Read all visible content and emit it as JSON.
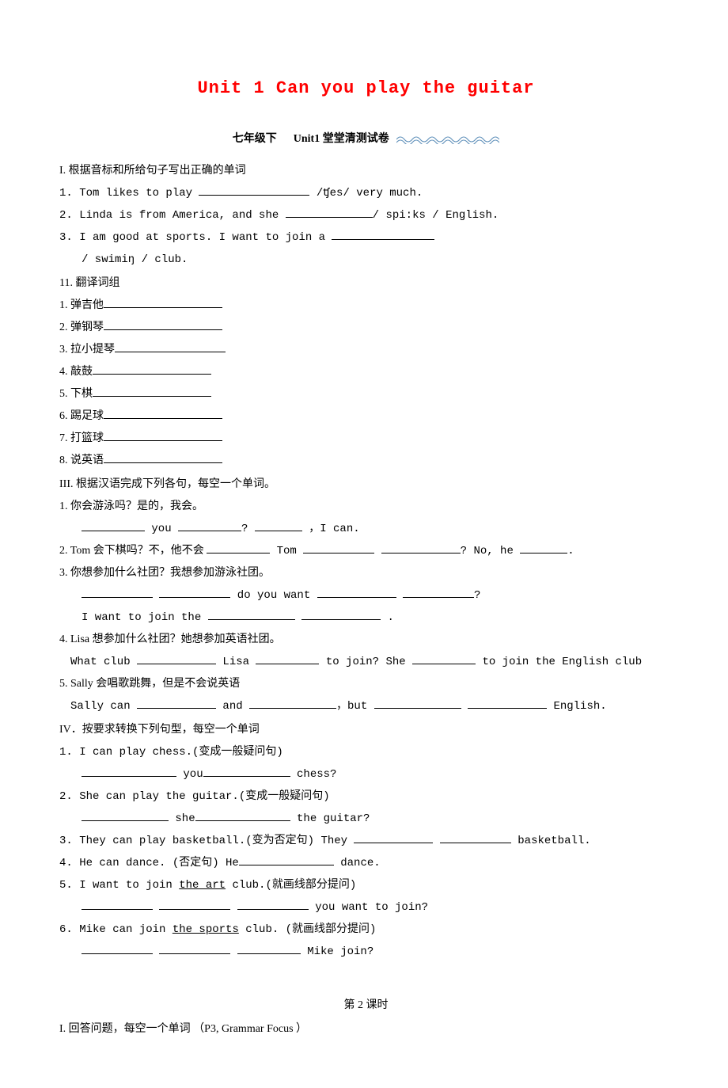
{
  "title": "Unit 1 Can you play the guitar",
  "subtitle_left": "七年级下",
  "subtitle_right": "Unit1 堂堂清测试卷",
  "section1": {
    "header": "I. 根据音标和所给句子写出正确的单词",
    "q1_a": "1. Tom likes to play ",
    "q1_b": " /ʧes/ very much.",
    "q2_a": "2. Linda is from America, and she ",
    "q2_b": "/ spi:ks / English.",
    "q3_a": "3. I am good at sports. I want to join a ",
    "q3_b": " ",
    "q3_line2": "/ swimiŋ / club."
  },
  "section2": {
    "header": "11. 翻译词组",
    "items": [
      "1. 弹吉他",
      "2. 弹钢琴",
      "3. 拉小提琴",
      "4. 敲鼓",
      "5. 下棋",
      "6. 踢足球",
      "7. 打篮球",
      "8. 说英语"
    ]
  },
  "section3": {
    "header": "III. 根据汉语完成下列各句，每空一个单词。",
    "q1": "1. 你会游泳吗？是的，我会。",
    "q1_frag1": " you ",
    "q1_frag2": "?   ",
    "q1_frag3": " ，I can.",
    "q2_a": "2.  Tom 会下棋吗？不，他不会 ",
    "q2_b": " Tom ",
    "q2_c": " ",
    "q2_d": "?  No, he ",
    "q2_e": ".",
    "q3": "3. 你想参加什么社团？我想参加游泳社团。",
    "q3_mid": " do you want ",
    "q3_end": "?",
    "q3_line2a": "I want to join the ",
    "q3_line2b": " .",
    "q4": "4. Lisa 想参加什么社团？她想参加英语社团。",
    "q4_a": "What club ",
    "q4_b": " Lisa ",
    "q4_c": " to join? She ",
    "q4_d": " to join the English club",
    "q5": "5. Sally 会唱歌跳舞，但是不会说英语",
    "q5_a": "Sally can ",
    "q5_b": " and ",
    "q5_c": "，but ",
    "q5_d": " ",
    "q5_e": " English."
  },
  "section4": {
    "header": "IV．按要求转换下列句型，每空一个单词",
    "q1": "1. I can play chess.(变成一般疑问句)",
    "q1_a": " you",
    "q1_b": " chess?",
    "q2": "2. She can play the guitar.(变成一般疑问句)",
    "q2_a": " she",
    "q2_b": " the guitar?",
    "q3_a": "3. They can play basketball.(变为否定句) They ",
    "q3_b": " ",
    "q3_c": " basketball.",
    "q4_a": "4. He can dance. (否定句) He",
    "q4_b": " dance.",
    "q5": "5. I want to join ",
    "q5_u": "the art",
    "q5_b": " club.(就画线部分提问)",
    "q5_line2": " you  want to join?",
    "q6": "6. Mike can join ",
    "q6_u": "the sports",
    "q6_b": " club. (就画线部分提问)",
    "q6_line2": " Mike join?"
  },
  "lesson2": "第 2 课时",
  "section5": {
    "header": "I. 回答问题，每空一个单词 （P3, Grammar Focus ）"
  }
}
